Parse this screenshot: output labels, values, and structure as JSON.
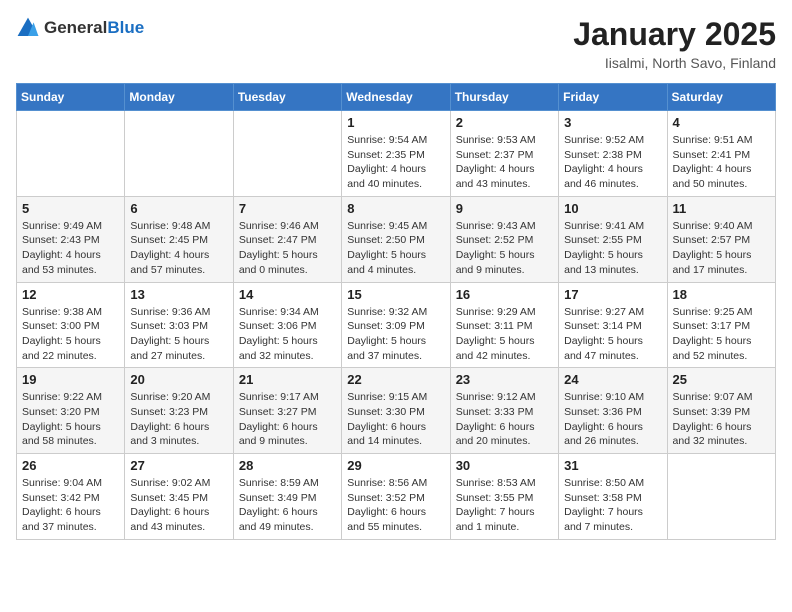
{
  "header": {
    "logo_general": "General",
    "logo_blue": "Blue",
    "month_title": "January 2025",
    "location": "Iisalmi, North Savo, Finland"
  },
  "weekdays": [
    "Sunday",
    "Monday",
    "Tuesday",
    "Wednesday",
    "Thursday",
    "Friday",
    "Saturday"
  ],
  "weeks": [
    {
      "days": [
        {
          "number": "",
          "info": ""
        },
        {
          "number": "",
          "info": ""
        },
        {
          "number": "",
          "info": ""
        },
        {
          "number": "1",
          "info": "Sunrise: 9:54 AM\nSunset: 2:35 PM\nDaylight: 4 hours and 40 minutes."
        },
        {
          "number": "2",
          "info": "Sunrise: 9:53 AM\nSunset: 2:37 PM\nDaylight: 4 hours and 43 minutes."
        },
        {
          "number": "3",
          "info": "Sunrise: 9:52 AM\nSunset: 2:38 PM\nDaylight: 4 hours and 46 minutes."
        },
        {
          "number": "4",
          "info": "Sunrise: 9:51 AM\nSunset: 2:41 PM\nDaylight: 4 hours and 50 minutes."
        }
      ]
    },
    {
      "days": [
        {
          "number": "5",
          "info": "Sunrise: 9:49 AM\nSunset: 2:43 PM\nDaylight: 4 hours and 53 minutes."
        },
        {
          "number": "6",
          "info": "Sunrise: 9:48 AM\nSunset: 2:45 PM\nDaylight: 4 hours and 57 minutes."
        },
        {
          "number": "7",
          "info": "Sunrise: 9:46 AM\nSunset: 2:47 PM\nDaylight: 5 hours and 0 minutes."
        },
        {
          "number": "8",
          "info": "Sunrise: 9:45 AM\nSunset: 2:50 PM\nDaylight: 5 hours and 4 minutes."
        },
        {
          "number": "9",
          "info": "Sunrise: 9:43 AM\nSunset: 2:52 PM\nDaylight: 5 hours and 9 minutes."
        },
        {
          "number": "10",
          "info": "Sunrise: 9:41 AM\nSunset: 2:55 PM\nDaylight: 5 hours and 13 minutes."
        },
        {
          "number": "11",
          "info": "Sunrise: 9:40 AM\nSunset: 2:57 PM\nDaylight: 5 hours and 17 minutes."
        }
      ]
    },
    {
      "days": [
        {
          "number": "12",
          "info": "Sunrise: 9:38 AM\nSunset: 3:00 PM\nDaylight: 5 hours and 22 minutes."
        },
        {
          "number": "13",
          "info": "Sunrise: 9:36 AM\nSunset: 3:03 PM\nDaylight: 5 hours and 27 minutes."
        },
        {
          "number": "14",
          "info": "Sunrise: 9:34 AM\nSunset: 3:06 PM\nDaylight: 5 hours and 32 minutes."
        },
        {
          "number": "15",
          "info": "Sunrise: 9:32 AM\nSunset: 3:09 PM\nDaylight: 5 hours and 37 minutes."
        },
        {
          "number": "16",
          "info": "Sunrise: 9:29 AM\nSunset: 3:11 PM\nDaylight: 5 hours and 42 minutes."
        },
        {
          "number": "17",
          "info": "Sunrise: 9:27 AM\nSunset: 3:14 PM\nDaylight: 5 hours and 47 minutes."
        },
        {
          "number": "18",
          "info": "Sunrise: 9:25 AM\nSunset: 3:17 PM\nDaylight: 5 hours and 52 minutes."
        }
      ]
    },
    {
      "days": [
        {
          "number": "19",
          "info": "Sunrise: 9:22 AM\nSunset: 3:20 PM\nDaylight: 5 hours and 58 minutes."
        },
        {
          "number": "20",
          "info": "Sunrise: 9:20 AM\nSunset: 3:23 PM\nDaylight: 6 hours and 3 minutes."
        },
        {
          "number": "21",
          "info": "Sunrise: 9:17 AM\nSunset: 3:27 PM\nDaylight: 6 hours and 9 minutes."
        },
        {
          "number": "22",
          "info": "Sunrise: 9:15 AM\nSunset: 3:30 PM\nDaylight: 6 hours and 14 minutes."
        },
        {
          "number": "23",
          "info": "Sunrise: 9:12 AM\nSunset: 3:33 PM\nDaylight: 6 hours and 20 minutes."
        },
        {
          "number": "24",
          "info": "Sunrise: 9:10 AM\nSunset: 3:36 PM\nDaylight: 6 hours and 26 minutes."
        },
        {
          "number": "25",
          "info": "Sunrise: 9:07 AM\nSunset: 3:39 PM\nDaylight: 6 hours and 32 minutes."
        }
      ]
    },
    {
      "days": [
        {
          "number": "26",
          "info": "Sunrise: 9:04 AM\nSunset: 3:42 PM\nDaylight: 6 hours and 37 minutes."
        },
        {
          "number": "27",
          "info": "Sunrise: 9:02 AM\nSunset: 3:45 PM\nDaylight: 6 hours and 43 minutes."
        },
        {
          "number": "28",
          "info": "Sunrise: 8:59 AM\nSunset: 3:49 PM\nDaylight: 6 hours and 49 minutes."
        },
        {
          "number": "29",
          "info": "Sunrise: 8:56 AM\nSunset: 3:52 PM\nDaylight: 6 hours and 55 minutes."
        },
        {
          "number": "30",
          "info": "Sunrise: 8:53 AM\nSunset: 3:55 PM\nDaylight: 7 hours and 1 minute."
        },
        {
          "number": "31",
          "info": "Sunrise: 8:50 AM\nSunset: 3:58 PM\nDaylight: 7 hours and 7 minutes."
        },
        {
          "number": "",
          "info": ""
        }
      ]
    }
  ]
}
